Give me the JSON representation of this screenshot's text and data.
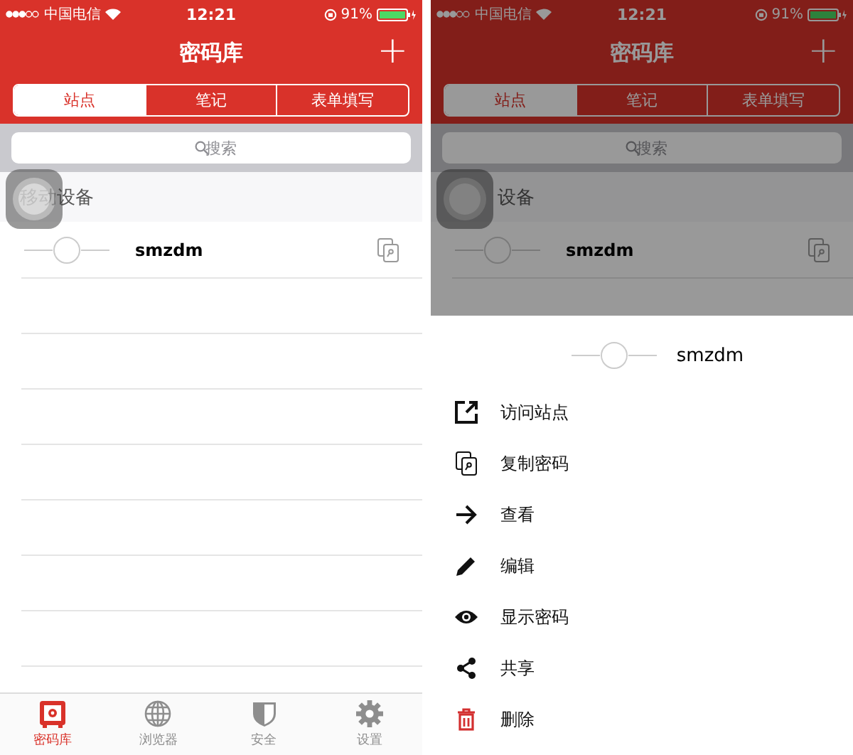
{
  "screens": [
    {
      "status_bar": {
        "carrier": "中国电信",
        "time": "12:21",
        "battery": "91%"
      },
      "title": "密码库",
      "add_button": "+",
      "tabs": [
        {
          "label": "站点",
          "selected": true
        },
        {
          "label": "笔记",
          "selected": false
        },
        {
          "label": "表单填写",
          "selected": false
        }
      ],
      "search": {
        "placeholder": "搜索"
      },
      "section": "移动设备",
      "items": [
        {
          "name": "smzdm"
        }
      ],
      "dimmed": false,
      "tab_bar": [
        {
          "label": "密码库",
          "selected": true
        },
        {
          "label": "浏览器",
          "selected": false
        },
        {
          "label": "安全",
          "selected": false
        },
        {
          "label": "设置",
          "selected": false
        }
      ]
    },
    {
      "status_bar": {
        "carrier": "中国电信",
        "time": "12:21",
        "battery": "91%"
      },
      "title": "密码库",
      "add_button": "+",
      "tabs": [
        {
          "label": "站点",
          "selected": true
        },
        {
          "label": "笔记",
          "selected": false
        },
        {
          "label": "表单填写",
          "selected": false
        }
      ],
      "search": {
        "placeholder": "搜索"
      },
      "section": "设备",
      "items": [
        {
          "name": "smzdm"
        }
      ],
      "dimmed": true,
      "action_sheet": {
        "title": "smzdm",
        "actions": [
          {
            "label": "访问站点",
            "kind": "normal"
          },
          {
            "label": "复制密码",
            "kind": "normal"
          },
          {
            "label": "查看",
            "kind": "normal"
          },
          {
            "label": "编辑",
            "kind": "normal"
          },
          {
            "label": "显示密码",
            "kind": "normal"
          },
          {
            "label": "共享",
            "kind": "normal"
          },
          {
            "label": "删除",
            "kind": "destructive"
          }
        ]
      }
    }
  ]
}
